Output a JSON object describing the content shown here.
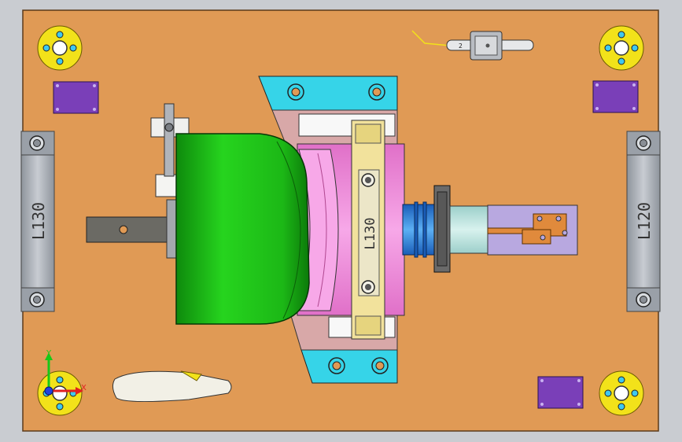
{
  "viewport": {
    "background": "#c9ccd1"
  },
  "colors": {
    "base_plate": "#e09a55",
    "locating_pad": "#7a3fb8",
    "clamp_body": "#22c41c",
    "fixture_block": "#f08ad8",
    "bracket": "#36d4e8",
    "cross_bar": "#f2e29c",
    "support_rail": "#a9afb8",
    "bolt_flange": "#f2e21a",
    "cylinder": "#3c8ce0",
    "pin_holder": "#b8a8e0",
    "pin_tab": "#e08a3c"
  },
  "labels": {
    "left_rail": "L130",
    "right_rail": "L120",
    "center_bar": "L130",
    "tag": "2"
  },
  "axis_triad": {
    "y": "Y",
    "x": "X"
  },
  "icons": {
    "flange": "bolt-flange-icon",
    "triad": "axis-triad-icon"
  }
}
